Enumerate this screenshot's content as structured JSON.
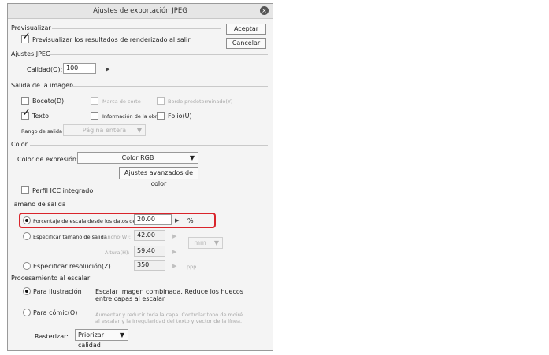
{
  "dialog": {
    "title": "Ajustes de exportación JPEG",
    "ok_label": "Aceptar",
    "cancel_label": "Cancelar"
  },
  "preview": {
    "section": "Previsualizar",
    "checkbox_label": "Previsualizar los resultados de renderizado al salir",
    "checked": true
  },
  "jpeg": {
    "section": "Ajustes JPEG",
    "quality_label": "Calidad(Q):",
    "quality_value": "100"
  },
  "output_image": {
    "section": "Salida de la imagen",
    "items": [
      {
        "label": "Boceto(D)",
        "checked": false,
        "enabled": true
      },
      {
        "label": "Marca de corte",
        "checked": false,
        "enabled": false
      },
      {
        "label": "Borde predeterminado(Y)",
        "checked": false,
        "enabled": false
      },
      {
        "label": "Texto",
        "checked": true,
        "enabled": true
      },
      {
        "label": "Información de la obra",
        "checked": false,
        "enabled": true
      },
      {
        "label": "Folio(U)",
        "checked": false,
        "enabled": true
      }
    ],
    "range_label": "Rango de salida",
    "range_value": "Página entera"
  },
  "color": {
    "section": "Color",
    "expression_label": "Color de expresión:",
    "expression_value": "Color RGB",
    "advanced_button": "Ajustes avanzados de color",
    "icc_label": "Perfil ICC integrado"
  },
  "size": {
    "section": "Tamaño de salida",
    "scale_label": "Porcentaje de escala desde los datos de or",
    "scale_value": "20.00",
    "scale_unit": "%",
    "specify_size_label": "Especificar tamaño de salida",
    "width_label": "Ancho(W):",
    "width_value": "42.00",
    "height_label": "Altura(H):",
    "height_value": "59.40",
    "size_unit": "mm",
    "resolution_label": "Especificar resolución(Z)",
    "resolution_value": "350",
    "resolution_unit": "ppp"
  },
  "scaling": {
    "section": "Procesamiento al escalar",
    "illustration_label": "Para ilustración",
    "illustration_desc_1": "Escalar imagen combinada. Reduce los huecos",
    "illustration_desc_2": "entre capas al escalar",
    "comic_label": "Para cómic(O)",
    "comic_desc_1": "Aumentar y reducir toda la capa. Controlar tono de moiré",
    "comic_desc_2": "al escalar y la irregularidad del texto y vector de la línea.",
    "rasterize_label": "Rasterizar:",
    "rasterize_value": "Priorizar calidad"
  },
  "colors": {
    "highlight": "#d9242b"
  }
}
